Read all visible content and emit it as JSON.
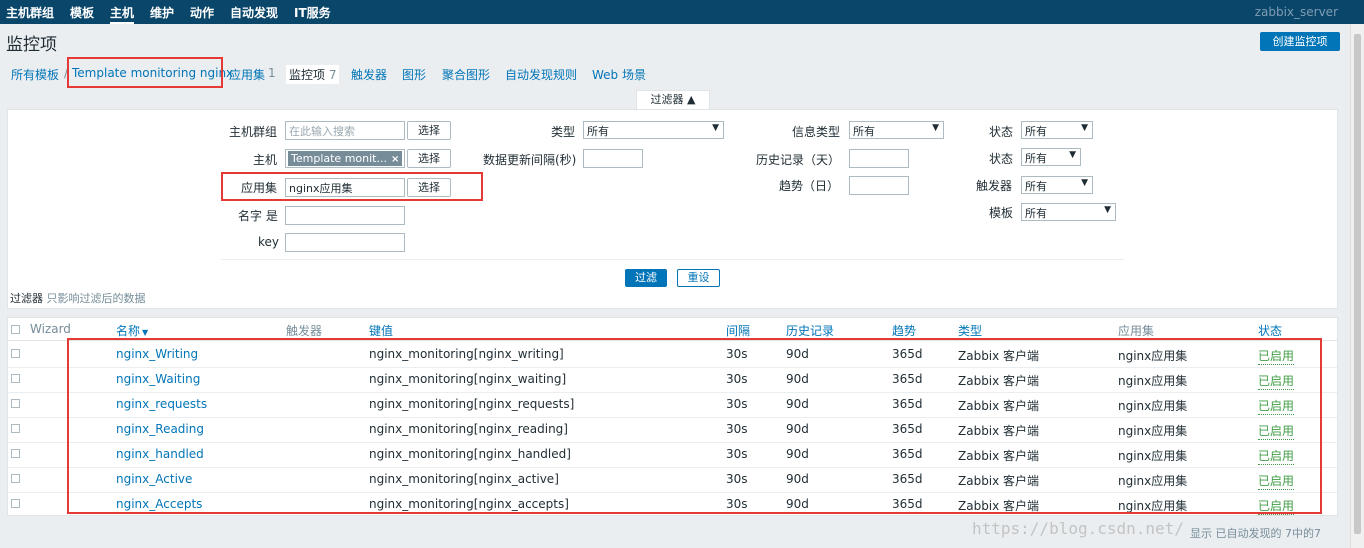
{
  "nav": {
    "items": [
      "主机群组",
      "模板",
      "主机",
      "维护",
      "动作",
      "自动发现",
      "IT服务"
    ],
    "server": "zabbix_server"
  },
  "page": {
    "title": "监控项",
    "create_button": "创建监控项"
  },
  "breadcrumb": {
    "all_templates": "所有模板",
    "separator": "/",
    "template": "Template monitoring nginx",
    "applications": "应用集",
    "applications_count": "1",
    "items": "监控项",
    "items_count": "7",
    "triggers": "触发器",
    "graphs": "图形",
    "screens": "聚合图形",
    "discovery": "自动发现规则",
    "web": "Web 场景"
  },
  "filter": {
    "tab_label": "过滤器 ▲",
    "host_group_label": "主机群组",
    "host_group_placeholder": "在此输入搜索",
    "select_label": "选择",
    "host_label": "主机",
    "host_tag": "Template monit...",
    "tag_remove": "×",
    "application_label": "应用集",
    "application_value": "nginx应用集",
    "name_label": "名字 是",
    "key_label": "key",
    "type_label": "类型",
    "type_value": "所有",
    "update_interval_label": "数据更新间隔(秒)",
    "info_type_label": "信息类型",
    "info_type_value": "所有",
    "history_label": "历史记录（天）",
    "trends_label": "趋势（日）",
    "state_label": "状态",
    "state_value": "所有",
    "status_label": "状态",
    "status_value": "所有",
    "triggers_label": "触发器",
    "triggers_value": "所有",
    "template_label": "模板",
    "template_value": "所有",
    "apply_button": "过滤",
    "reset_button": "重设",
    "note_title": "过滤器",
    "note_text": "只影响过滤后的数据"
  },
  "table": {
    "headers": {
      "wizard": "Wizard",
      "name": "名称",
      "sort_icon": "▼",
      "triggers": "触发器",
      "key": "键值",
      "interval": "间隔",
      "history": "历史记录",
      "trends": "趋势",
      "type": "类型",
      "applications": "应用集",
      "status": "状态"
    },
    "rows": [
      {
        "name": "nginx_Writing",
        "key": "nginx_monitoring[nginx_writing]",
        "interval": "30s",
        "history": "90d",
        "trends": "365d",
        "type": "Zabbix 客户端",
        "app": "nginx应用集",
        "status": "已启用"
      },
      {
        "name": "nginx_Waiting",
        "key": "nginx_monitoring[nginx_waiting]",
        "interval": "30s",
        "history": "90d",
        "trends": "365d",
        "type": "Zabbix 客户端",
        "app": "nginx应用集",
        "status": "已启用"
      },
      {
        "name": "nginx_requests",
        "key": "nginx_monitoring[nginx_requests]",
        "interval": "30s",
        "history": "90d",
        "trends": "365d",
        "type": "Zabbix 客户端",
        "app": "nginx应用集",
        "status": "已启用"
      },
      {
        "name": "nginx_Reading",
        "key": "nginx_monitoring[nginx_reading]",
        "interval": "30s",
        "history": "90d",
        "trends": "365d",
        "type": "Zabbix 客户端",
        "app": "nginx应用集",
        "status": "已启用"
      },
      {
        "name": "nginx_handled",
        "key": "nginx_monitoring[nginx_handled]",
        "interval": "30s",
        "history": "90d",
        "trends": "365d",
        "type": "Zabbix 客户端",
        "app": "nginx应用集",
        "status": "已启用"
      },
      {
        "name": "nginx_Active",
        "key": "nginx_monitoring[nginx_active]",
        "interval": "30s",
        "history": "90d",
        "trends": "365d",
        "type": "Zabbix 客户端",
        "app": "nginx应用集",
        "status": "已启用"
      },
      {
        "name": "nginx_Accepts",
        "key": "nginx_monitoring[nginx_accepts]",
        "interval": "30s",
        "history": "90d",
        "trends": "365d",
        "type": "Zabbix 客户端",
        "app": "nginx应用集",
        "status": "已启用"
      }
    ]
  },
  "footer": {
    "summary": "显示 已自动发现的 7中的7",
    "watermark": "https://blog.csdn.net/"
  }
}
